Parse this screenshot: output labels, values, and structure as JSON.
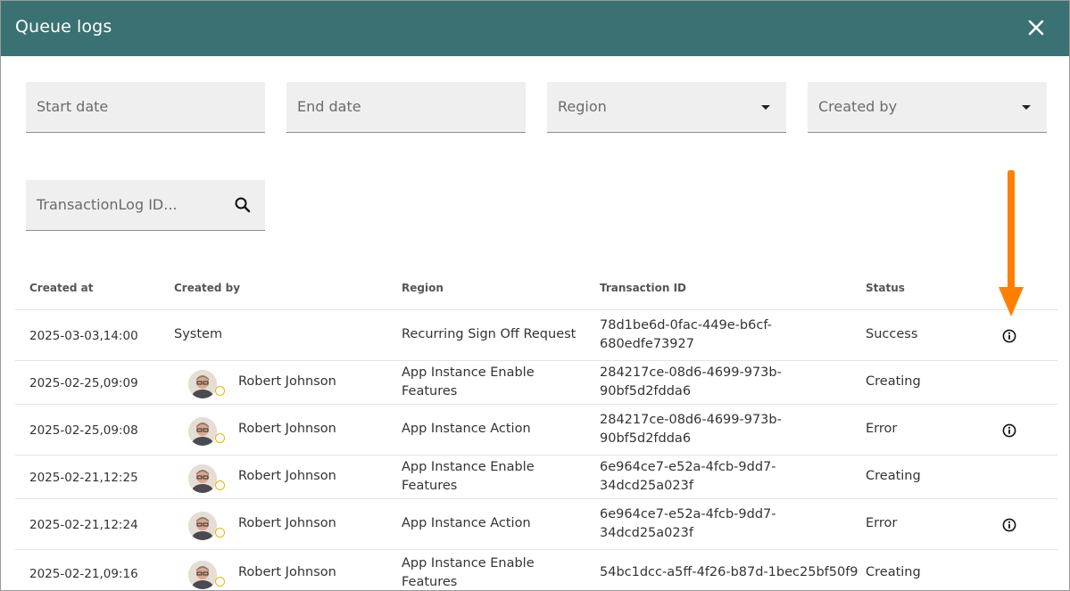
{
  "dialog": {
    "title": "Queue logs",
    "close_icon": "close-icon"
  },
  "filters": {
    "start_date": {
      "placeholder": "Start date"
    },
    "end_date": {
      "placeholder": "End date"
    },
    "region": {
      "placeholder": "Region"
    },
    "created_by": {
      "placeholder": "Created by"
    },
    "transaction_search": {
      "placeholder": "TransactionLog ID...",
      "icon": "search-icon"
    }
  },
  "table": {
    "columns": [
      "Created at",
      "Created by",
      "Region",
      "Transaction ID",
      "Status"
    ],
    "rows": [
      {
        "created_at": "2025-03-03,14:00",
        "created_by": "System",
        "has_avatar": false,
        "region_l1": "Recurring Sign Off Request",
        "region_l2": "",
        "tx_l1": "78d1be6d-0fac-449e-b6cf-",
        "tx_l2": "680edfe73927",
        "status": "Success",
        "has_info": true
      },
      {
        "created_at": "2025-02-25,09:09",
        "created_by": "Robert Johnson",
        "has_avatar": true,
        "region_l1": "App Instance Enable",
        "region_l2": "Features",
        "tx_l1": "284217ce-08d6-4699-973b-",
        "tx_l2": "90bf5d2fdda6",
        "status": "Creating",
        "has_info": false
      },
      {
        "created_at": "2025-02-25,09:08",
        "created_by": "Robert Johnson",
        "has_avatar": true,
        "region_l1": "App Instance Action",
        "region_l2": "",
        "tx_l1": "284217ce-08d6-4699-973b-",
        "tx_l2": "90bf5d2fdda6",
        "status": "Error",
        "has_info": true
      },
      {
        "created_at": "2025-02-21,12:25",
        "created_by": "Robert Johnson",
        "has_avatar": true,
        "region_l1": "App Instance Enable",
        "region_l2": "Features",
        "tx_l1": "6e964ce7-e52a-4fcb-9dd7-",
        "tx_l2": "34dcd25a023f",
        "status": "Creating",
        "has_info": false
      },
      {
        "created_at": "2025-02-21,12:24",
        "created_by": "Robert Johnson",
        "has_avatar": true,
        "region_l1": "App Instance Action",
        "region_l2": "",
        "tx_l1": "6e964ce7-e52a-4fcb-9dd7-",
        "tx_l2": "34dcd25a023f",
        "status": "Error",
        "has_info": true
      },
      {
        "created_at": "2025-02-21,09:16",
        "created_by": "Robert Johnson",
        "has_avatar": true,
        "region_l1": "App Instance Enable",
        "region_l2": "Features",
        "tx_l1": "54bc1dcc-a5ff-4f26-b87d-1bec25bf50f9",
        "tx_l2": "",
        "status": "Creating",
        "has_info": false
      }
    ]
  },
  "annotation": {
    "arrow_color": "#ff7f00"
  },
  "colors": {
    "header_bg": "#3a7173",
    "field_bg": "#efefef",
    "pending_dot": "#f0b400"
  }
}
